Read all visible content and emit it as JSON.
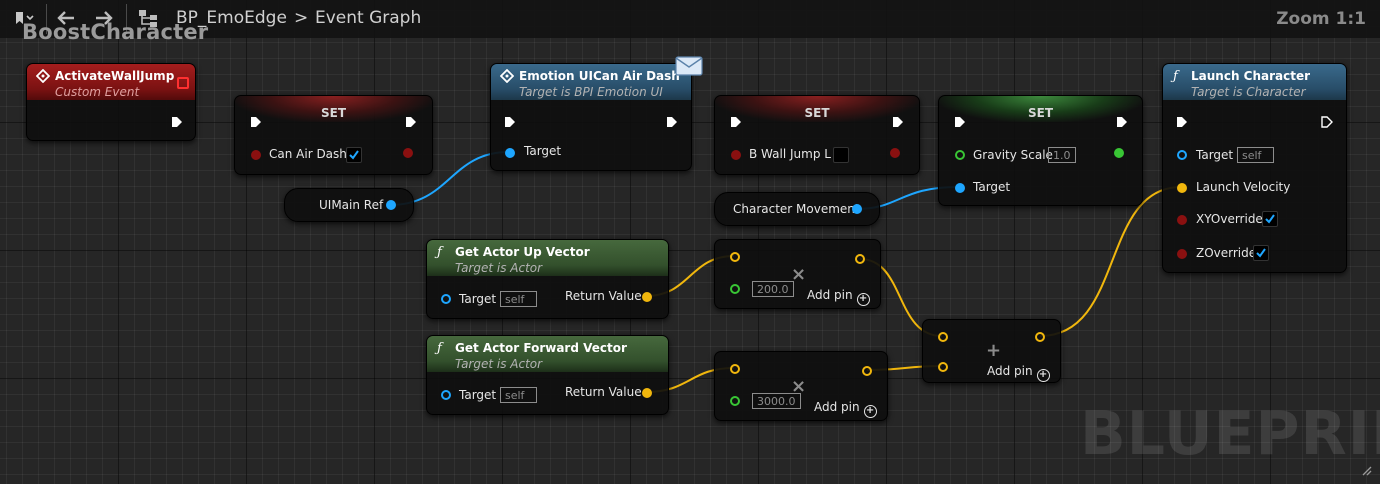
{
  "toolbar": {
    "bookmark_icon": "bookmark-icon",
    "back_icon": "back-arrow-icon",
    "forward_icon": "forward-arrow-icon",
    "hierarchy_icon": "hierarchy-icon",
    "breadcrumb": [
      "BP_EmoEdge",
      "Event Graph"
    ],
    "breadcrumb_separator": ">",
    "zoom": "Zoom 1:1"
  },
  "graph_title": "BoostCharacter",
  "watermark": "BLUEPRINT",
  "colors": {
    "exec": "#ffffff",
    "object": "#1ea6ff",
    "vector": "#f1b70d",
    "bool": "#8a1010",
    "float": "#39c635",
    "event_header": "#a51d1d",
    "message_header": "#3a6a8c",
    "function_header": "#46693d"
  },
  "nodes": {
    "activate_wall_jump": {
      "title": "ActivateWallJump",
      "subtitle": "Custom Event"
    },
    "set_can_air_dash": {
      "header": "SET",
      "pin_label": "Can Air Dash",
      "checked": true
    },
    "uimain_ref": {
      "label": "UIMain Ref"
    },
    "emotion_ui": {
      "title": "Emotion UICan Air Dash",
      "subtitle": "Target is BPI Emotion UI",
      "pin_label": "Target"
    },
    "set_wall_jump": {
      "header": "SET",
      "pin_label": "B Wall Jump L",
      "checked": false
    },
    "character_movement": {
      "label": "Character Movement"
    },
    "set_gravity": {
      "header": "SET",
      "pin_gravity": "Gravity Scale",
      "gravity_value": "1.0",
      "pin_target": "Target"
    },
    "launch_character": {
      "title": "Launch Character",
      "subtitle": "Target is Character",
      "pin_target": "Target",
      "target_value": "self",
      "pin_velocity": "Launch Velocity",
      "pin_xy": "XYOverride",
      "xy_checked": true,
      "pin_z": "ZOverride",
      "z_checked": true
    },
    "get_up_vector": {
      "title": "Get Actor Up Vector",
      "subtitle": "Target is Actor",
      "pin_target": "Target",
      "target_value": "self",
      "pin_return": "Return Value"
    },
    "get_forward_vector": {
      "title": "Get Actor Forward Vector",
      "subtitle": "Target is Actor",
      "pin_target": "Target",
      "target_value": "self",
      "pin_return": "Return Value"
    },
    "multiply_up": {
      "symbol": "×",
      "value": "200.0",
      "add_pin": "Add pin"
    },
    "multiply_forward": {
      "symbol": "×",
      "value": "3000.0",
      "add_pin": "Add pin"
    },
    "add_vectors": {
      "symbol": "+",
      "add_pin": "Add pin"
    }
  }
}
